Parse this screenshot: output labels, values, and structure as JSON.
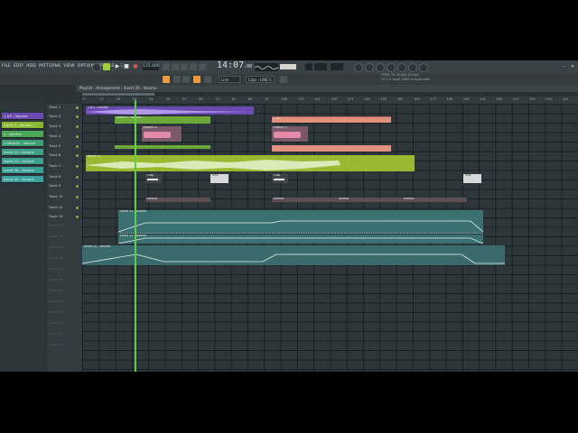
{
  "menu": [
    "FILE",
    "EDIT",
    "ADD",
    "PATTERNS",
    "VIEW",
    "OPTIONS",
    "TOOLS",
    "HELP"
  ],
  "hint": {
    "line1": "Improved Slip",
    "line2": "14:08:15"
  },
  "transport": {
    "tempo": "125.000",
    "time": "14:07",
    "time_sub": ":00"
  },
  "toolbar": {
    "snap": "Line",
    "pattern": "Clap - LINE 5"
  },
  "news": {
    "line1": "FREE: FL Studio version",
    "line2": "20.7.2 build 1863 is available!"
  },
  "playlist_title": "Playlist - Arrangement › Insert 20 - Volume",
  "picker": [
    {
      "label": "1 #3 - Volume",
      "color": "#6a4ab0"
    },
    {
      "label": "Insert 9 - Volume",
      "color": "#8ab832"
    },
    {
      "label": "1 - Volume",
      "color": "#4aa858"
    },
    {
      "label": "LOWpASS - Volume",
      "color": "#3e9e76"
    },
    {
      "label": "Insert 12 - Volume",
      "color": "#3e9e86"
    },
    {
      "label": "Insert 13 - Volume",
      "color": "#3e9e90"
    },
    {
      "label": "Insert 16 - Volume",
      "color": "#3aa098"
    },
    {
      "label": "Insert 20 - Volume",
      "color": "#3aa0a0"
    }
  ],
  "ruler": [
    "9",
    "17",
    "25",
    "33",
    "41",
    "49",
    "57",
    "65",
    "73",
    "81",
    "89",
    "97",
    "105",
    "113",
    "121",
    "129",
    "137",
    "145",
    "153",
    "161",
    "169",
    "177",
    "185",
    "193",
    "201",
    "209",
    "217",
    "225",
    "233",
    "241"
  ],
  "tracks": [
    {
      "label": "Track 1",
      "active": true
    },
    {
      "label": "Track 2",
      "active": true
    },
    {
      "label": "Track 3",
      "active": true
    },
    {
      "label": "Track 4",
      "active": true
    },
    {
      "label": "Track 5",
      "active": true
    },
    {
      "label": "Track 6",
      "active": true
    },
    {
      "label": "Track 7",
      "active": true
    },
    {
      "label": "Track 8",
      "active": true
    },
    {
      "label": "Track 9",
      "active": true
    },
    {
      "label": "Track 10",
      "active": true
    },
    {
      "label": "Track 11",
      "active": true
    },
    {
      "label": "Track 12",
      "active": true
    },
    {
      "label": "Track 13",
      "active": false
    },
    {
      "label": "Track 14",
      "active": false
    },
    {
      "label": "Track 15",
      "active": false
    },
    {
      "label": "Track 16",
      "active": false
    },
    {
      "label": "Track 17",
      "active": false
    },
    {
      "label": "Track 18",
      "active": false
    },
    {
      "label": "Track 19",
      "active": false
    },
    {
      "label": "Track 20",
      "active": false
    },
    {
      "label": "Track 21",
      "active": false
    },
    {
      "label": "Track 22",
      "active": false
    },
    {
      "label": "Track 23",
      "active": false
    },
    {
      "label": "Track 24",
      "active": false
    }
  ],
  "clips": {
    "c1": "1 #3 - Volume",
    "c2": "Insert 9 - Volume",
    "c3": "1 #2",
    "c4": "Pattern 3",
    "c5": "Pattern 3",
    "c6": "Insert 11",
    "c7": "Clap",
    "c8": "Kick",
    "c9": "Clap",
    "c10": "Kick",
    "c11": "Reverb",
    "c12": "Reverb",
    "c13": "Reverb",
    "c14": "Reverb",
    "c15": "Insert 12 - Volume",
    "c16": "Insert 13 - Volume",
    "c17": "Insert 20 - Volume"
  }
}
